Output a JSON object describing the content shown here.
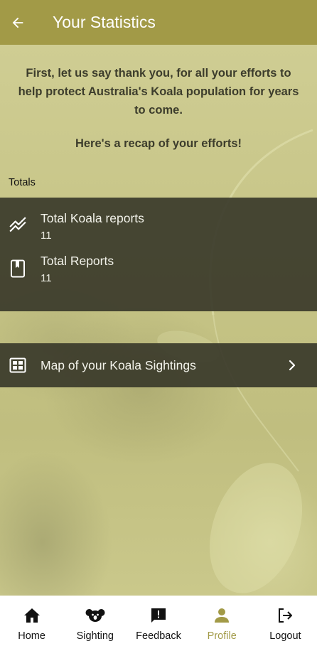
{
  "app_bar": {
    "title": "Your Statistics",
    "back_icon": "arrow-left-icon"
  },
  "intro": {
    "message": "First, let us say thank you, for all your efforts to help protect Australia's Koala population for years to come.",
    "recap": "Here's a recap of your efforts!"
  },
  "totals": {
    "label": "Totals",
    "items": [
      {
        "icon": "trending-icon",
        "title": "Total Koala reports",
        "value": "11"
      },
      {
        "icon": "bookmark-book-icon",
        "title": "Total Reports",
        "value": "11"
      }
    ]
  },
  "map_link": {
    "icon": "dashboard-grid-icon",
    "label": "Map of your Koala Sightings",
    "chevron_icon": "chevron-right-icon"
  },
  "bottom_nav": {
    "active": "Profile",
    "items": [
      {
        "icon": "home-icon",
        "label": "Home"
      },
      {
        "icon": "koala-icon",
        "label": "Sighting"
      },
      {
        "icon": "feedback-icon",
        "label": "Feedback"
      },
      {
        "icon": "person-icon",
        "label": "Profile"
      },
      {
        "icon": "logout-icon",
        "label": "Logout"
      }
    ]
  },
  "colors": {
    "app_bar": "#a29a47",
    "panel": "#3a3a2a",
    "active_nav": "#a29a47"
  }
}
